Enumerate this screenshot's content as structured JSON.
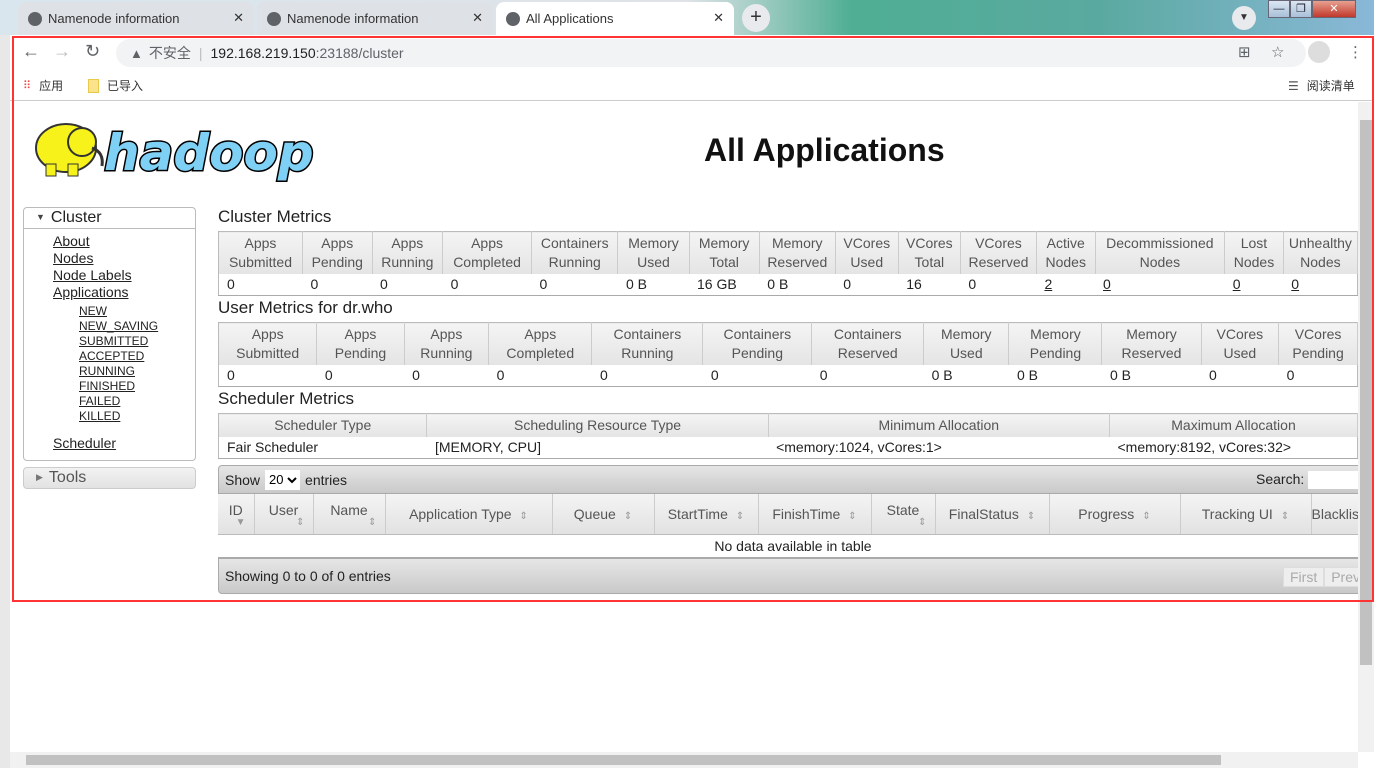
{
  "browser": {
    "tabs": [
      {
        "title": "Namenode information",
        "active": false
      },
      {
        "title": "Namenode information",
        "active": false
      },
      {
        "title": "All Applications",
        "active": true
      }
    ],
    "address": {
      "security_label": "不安全",
      "host": "192.168.219.150",
      "path": ":23188/cluster"
    },
    "bookmarks": {
      "apps": "应用",
      "imported": "已导入",
      "reading_list": "阅读清单"
    }
  },
  "page": {
    "logo_text": "hadoop",
    "title": "All Applications",
    "nav": {
      "cluster": "Cluster",
      "links": [
        "About",
        "Nodes",
        "Node Labels",
        "Applications"
      ],
      "states": [
        "NEW",
        "NEW_SAVING",
        "SUBMITTED",
        "ACCEPTED",
        "RUNNING",
        "FINISHED",
        "FAILED",
        "KILLED"
      ],
      "scheduler": "Scheduler",
      "tools": "Tools"
    },
    "cluster_metrics": {
      "title": "Cluster Metrics",
      "headers": [
        [
          "Apps",
          "Submitted"
        ],
        [
          "Apps",
          "Pending"
        ],
        [
          "Apps",
          "Running"
        ],
        [
          "Apps",
          "Completed"
        ],
        [
          "Containers",
          "Running"
        ],
        [
          "Memory",
          "Used"
        ],
        [
          "Memory",
          "Total"
        ],
        [
          "Memory",
          "Reserved"
        ],
        [
          "VCores",
          "Used"
        ],
        [
          "VCores",
          "Total"
        ],
        [
          "VCores",
          "Reserved"
        ],
        [
          "Active",
          "Nodes"
        ],
        [
          "Decommissioned",
          "Nodes"
        ],
        [
          "Lost",
          "Nodes"
        ],
        [
          "Unhealthy",
          "Nodes"
        ]
      ],
      "values": [
        "0",
        "0",
        "0",
        "0",
        "0",
        "0 B",
        "16 GB",
        "0 B",
        "0",
        "16",
        "0",
        "2",
        "0",
        "0",
        "0"
      ]
    },
    "user_metrics": {
      "title": "User Metrics for dr.who",
      "headers": [
        [
          "Apps",
          "Submitted"
        ],
        [
          "Apps",
          "Pending"
        ],
        [
          "Apps",
          "Running"
        ],
        [
          "Apps",
          "Completed"
        ],
        [
          "Containers",
          "Running"
        ],
        [
          "Containers",
          "Pending"
        ],
        [
          "Containers",
          "Reserved"
        ],
        [
          "Memory",
          "Used"
        ],
        [
          "Memory",
          "Pending"
        ],
        [
          "Memory",
          "Reserved"
        ],
        [
          "VCores",
          "Used"
        ],
        [
          "VCores",
          "Pending"
        ]
      ],
      "values": [
        "0",
        "0",
        "0",
        "0",
        "0",
        "0",
        "0",
        "0 B",
        "0 B",
        "0 B",
        "0",
        "0"
      ]
    },
    "scheduler_metrics": {
      "title": "Scheduler Metrics",
      "headers": [
        "Scheduler Type",
        "Scheduling Resource Type",
        "Minimum Allocation",
        "Maximum Allocation"
      ],
      "values": [
        "Fair Scheduler",
        "[MEMORY, CPU]",
        "<memory:1024, vCores:1>",
        "<memory:8192, vCores:32>"
      ]
    },
    "apps_table": {
      "show_label": "Show",
      "entries_label": "entries",
      "page_size": "20",
      "search_label": "Search:",
      "search_value": "",
      "columns": [
        "ID",
        "User",
        "Name",
        "Application Type",
        "Queue",
        "StartTime",
        "FinishTime",
        "State",
        "FinalStatus",
        "Progress",
        "Tracking UI",
        "Blacklisted Nodes"
      ],
      "empty": "No data available in table",
      "info": "Showing 0 to 0 of 0 entries",
      "pager": [
        "First",
        "Previous"
      ]
    }
  },
  "colors": {
    "annotation_frame": "#ff3333",
    "logo_blue": "#7fd0f5",
    "logo_yellow": "#f6f21a"
  }
}
